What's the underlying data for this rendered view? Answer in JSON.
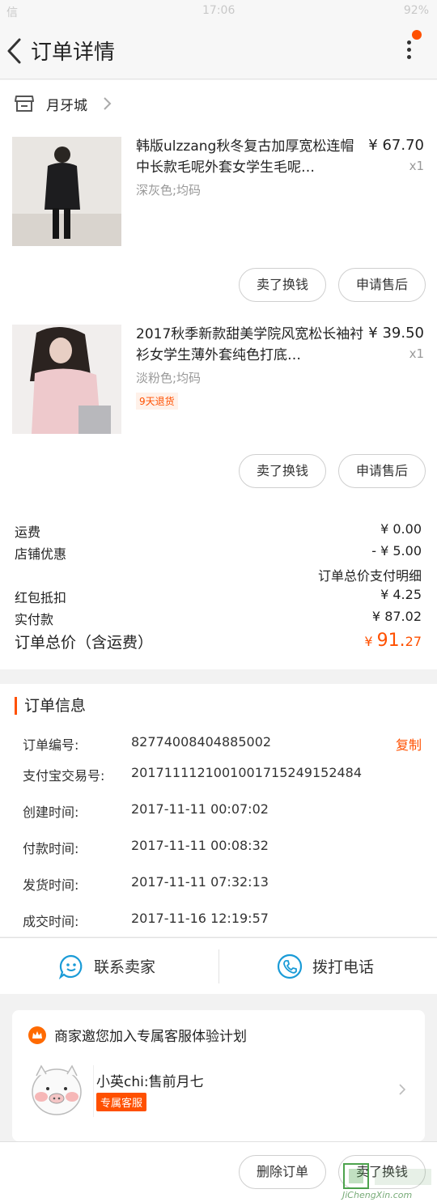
{
  "status_bar": {
    "left": "信",
    "time": "17:06",
    "right": "92%"
  },
  "nav": {
    "title": "订单详情"
  },
  "shop": {
    "name": "月牙城"
  },
  "items": [
    {
      "name": "韩版ulzzang秋冬复古加厚宽松连帽中长款毛呢外套女学生毛呢…",
      "price": "¥ 67.70",
      "qty": "x1",
      "sku": "深灰色;均码",
      "tag": "",
      "btn_sell": "卖了换钱",
      "btn_service": "申请售后"
    },
    {
      "name": "2017秋季新款甜美学院风宽松长袖衬衫女学生薄外套纯色打底…",
      "price": "¥ 39.50",
      "qty": "x1",
      "sku": "淡粉色;均码",
      "tag": "9天退货",
      "btn_sell": "卖了换钱",
      "btn_service": "申请售后"
    }
  ],
  "fees": {
    "shipping_label": "运费",
    "shipping_value": "¥ 0.00",
    "discount_label": "店铺优惠",
    "discount_value": "- ¥ 5.00",
    "detail_link": "订单总价支付明细",
    "redpacket_label": "红包抵扣",
    "redpacket_value": "¥ 4.25",
    "paid_label": "实付款",
    "paid_value": "¥ 87.02",
    "total_label": "订单总价（含运费）",
    "total_symbol": "¥ ",
    "total_int": "91.",
    "total_dec": "27"
  },
  "order_info": {
    "title": "订单信息",
    "copy_label": "复制",
    "rows": [
      {
        "k": "订单编号:",
        "v": "82774008404885002"
      },
      {
        "k": "支付宝交易号:",
        "v": "2017111121001001715249152484"
      },
      {
        "k": "创建时间:",
        "v": "2017-11-11 00:07:02"
      },
      {
        "k": "付款时间:",
        "v": "2017-11-11 00:08:32"
      },
      {
        "k": "发货时间:",
        "v": "2017-11-11 07:32:13"
      },
      {
        "k": "成交时间:",
        "v": "2017-11-16 12:19:57"
      }
    ]
  },
  "contact": {
    "seller": "联系卖家",
    "phone": "拨打电话"
  },
  "promo": {
    "title": "商家邀您加入专属客服体验计划",
    "agent": "小英chi:售前月七",
    "badge": "专属客服"
  },
  "bottom": {
    "delete": "删除订单",
    "sell": "卖了换钱"
  },
  "watermark": {
    "text": "JiChengXin.com"
  },
  "colors": {
    "accent": "#ff5000",
    "background": "#f2f2f2",
    "link_blue": "#1a9bd7"
  }
}
